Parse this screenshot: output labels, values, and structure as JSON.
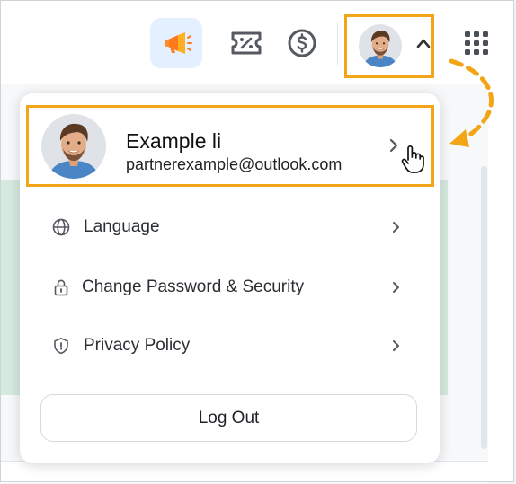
{
  "header": {
    "icons": [
      "megaphone-icon",
      "discount-ticket-icon",
      "dollar-circle-icon",
      "avatar",
      "chevron-up-icon",
      "apps-grid-icon"
    ]
  },
  "profile": {
    "name": "Example li",
    "email": "partnerexample@outlook.com"
  },
  "menu": {
    "items": [
      {
        "label": "Language",
        "icon": "globe-icon"
      },
      {
        "label": "Change Password & Security",
        "icon": "lock-icon"
      },
      {
        "label": "Privacy Policy",
        "icon": "shield-icon"
      }
    ],
    "logout_label": "Log Out"
  },
  "colors": {
    "highlight": "#f2a516",
    "accent_orange": "#ff7a1a",
    "announce_bg": "#e4efff"
  }
}
